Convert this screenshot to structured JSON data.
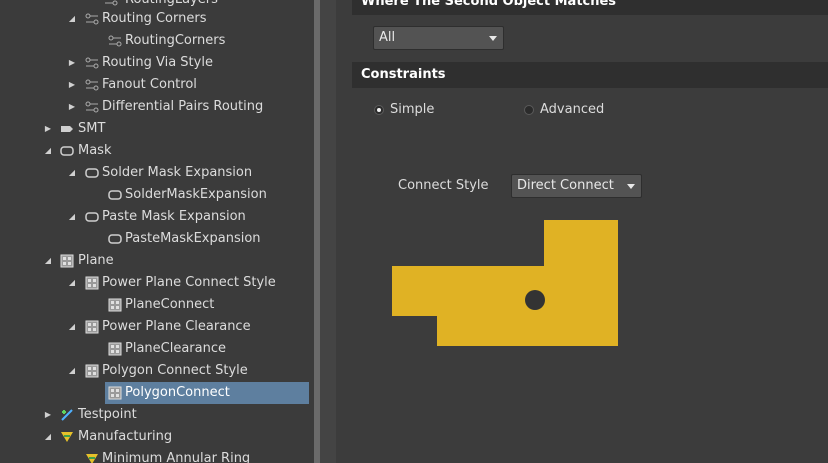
{
  "tree": {
    "items": [
      {
        "label": "RoutingLayers"
      },
      {
        "label": "Routing Corners"
      },
      {
        "label": "RoutingCorners"
      },
      {
        "label": "Routing Via Style"
      },
      {
        "label": "Fanout Control"
      },
      {
        "label": "Differential Pairs Routing"
      },
      {
        "label": "SMT"
      },
      {
        "label": "Mask"
      },
      {
        "label": "Solder Mask Expansion"
      },
      {
        "label": "SolderMaskExpansion"
      },
      {
        "label": "Paste Mask Expansion"
      },
      {
        "label": "PasteMaskExpansion"
      },
      {
        "label": "Plane"
      },
      {
        "label": "Power Plane Connect Style"
      },
      {
        "label": "PlaneConnect"
      },
      {
        "label": "Power Plane Clearance"
      },
      {
        "label": "PlaneClearance"
      },
      {
        "label": "Polygon Connect Style"
      },
      {
        "label": "PolygonConnect"
      },
      {
        "label": "Testpoint"
      },
      {
        "label": "Manufacturing"
      },
      {
        "label": "Minimum Annular Ring"
      }
    ]
  },
  "right": {
    "second_object_header": "Where The Second Object Matches",
    "scope_dropdown": "All",
    "constraints_header": "Constraints",
    "radio_simple": "Simple",
    "radio_advanced": "Advanced",
    "connect_style_label": "Connect Style",
    "connect_style_value": "Direct Connect"
  },
  "colors": {
    "copper": "#e0b224",
    "selection": "#5e7f9f",
    "hole": "#333333"
  }
}
